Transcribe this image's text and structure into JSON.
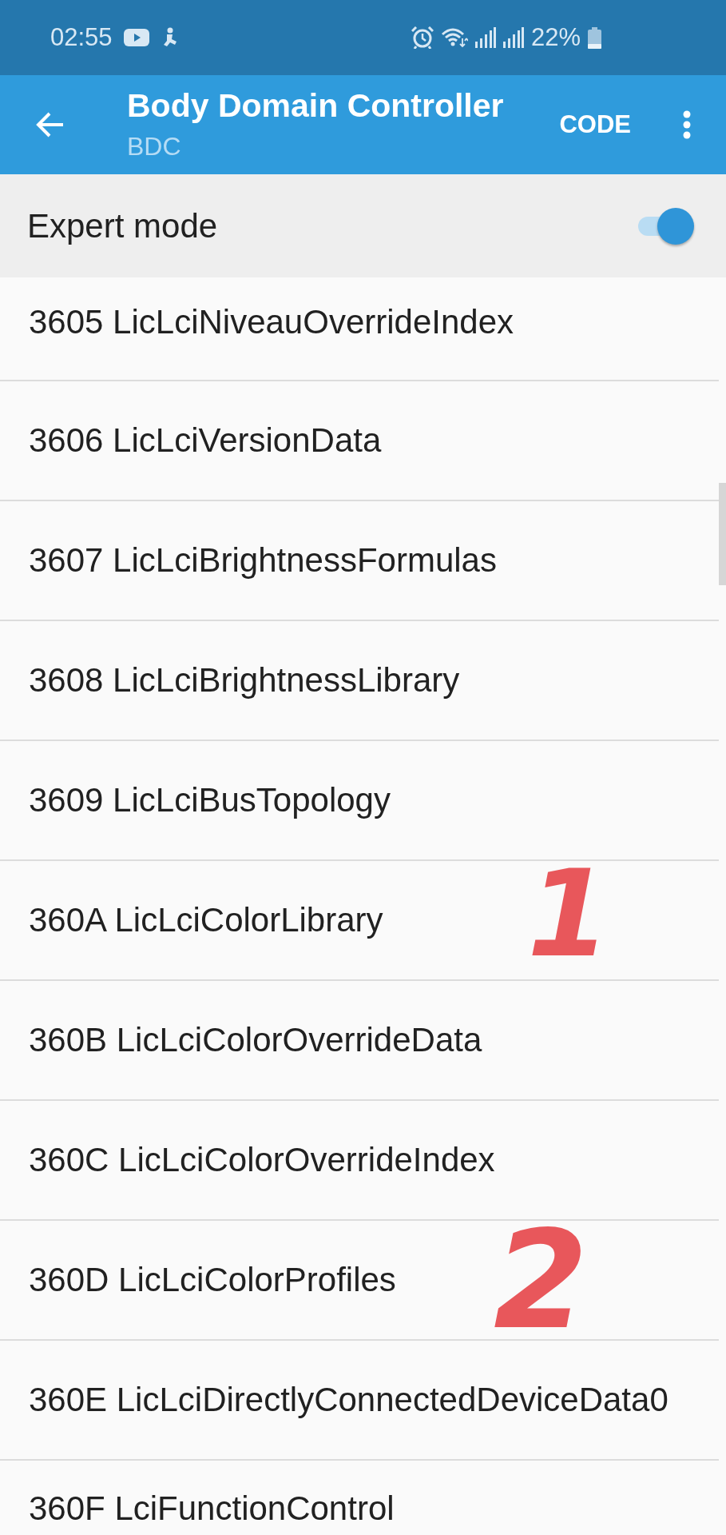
{
  "status_bar": {
    "time": "02:55",
    "battery": "22%"
  },
  "app_bar": {
    "title": "Body Domain Controller",
    "subtitle": "BDC",
    "action": "CODE"
  },
  "expert_mode": {
    "label": "Expert mode",
    "on": true
  },
  "items": [
    {
      "label": "3605 LicLciNiveauOverrideIndex"
    },
    {
      "label": "3606 LicLciVersionData"
    },
    {
      "label": "3607 LicLciBrightnessFormulas"
    },
    {
      "label": "3608 LicLciBrightnessLibrary"
    },
    {
      "label": "3609 LicLciBusTopology"
    },
    {
      "label": "360A LicLciColorLibrary",
      "annotation": "1"
    },
    {
      "label": "360B LicLciColorOverrideData"
    },
    {
      "label": "360C LicLciColorOverrideIndex"
    },
    {
      "label": "360D LicLciColorProfiles",
      "annotation": "2"
    },
    {
      "label": "360E LicLciDirectlyConnectedDeviceData0"
    },
    {
      "label": "360F LciFunctionControl"
    }
  ]
}
